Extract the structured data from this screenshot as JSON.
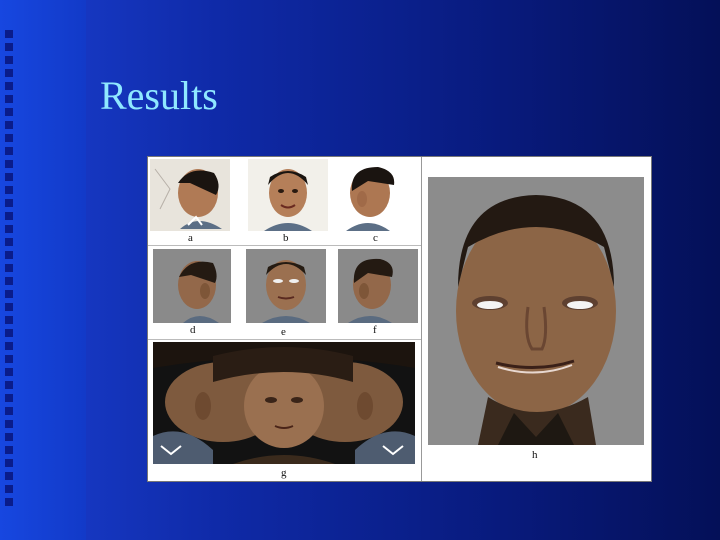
{
  "slide": {
    "title": "Results"
  },
  "figure": {
    "labels": {
      "a": "a",
      "b": "b",
      "c": "c",
      "d": "d",
      "e": "e",
      "f": "f",
      "g": "g",
      "h": "h"
    }
  },
  "colors": {
    "title": "#8fe8ff",
    "background": "#0f2aa8"
  }
}
